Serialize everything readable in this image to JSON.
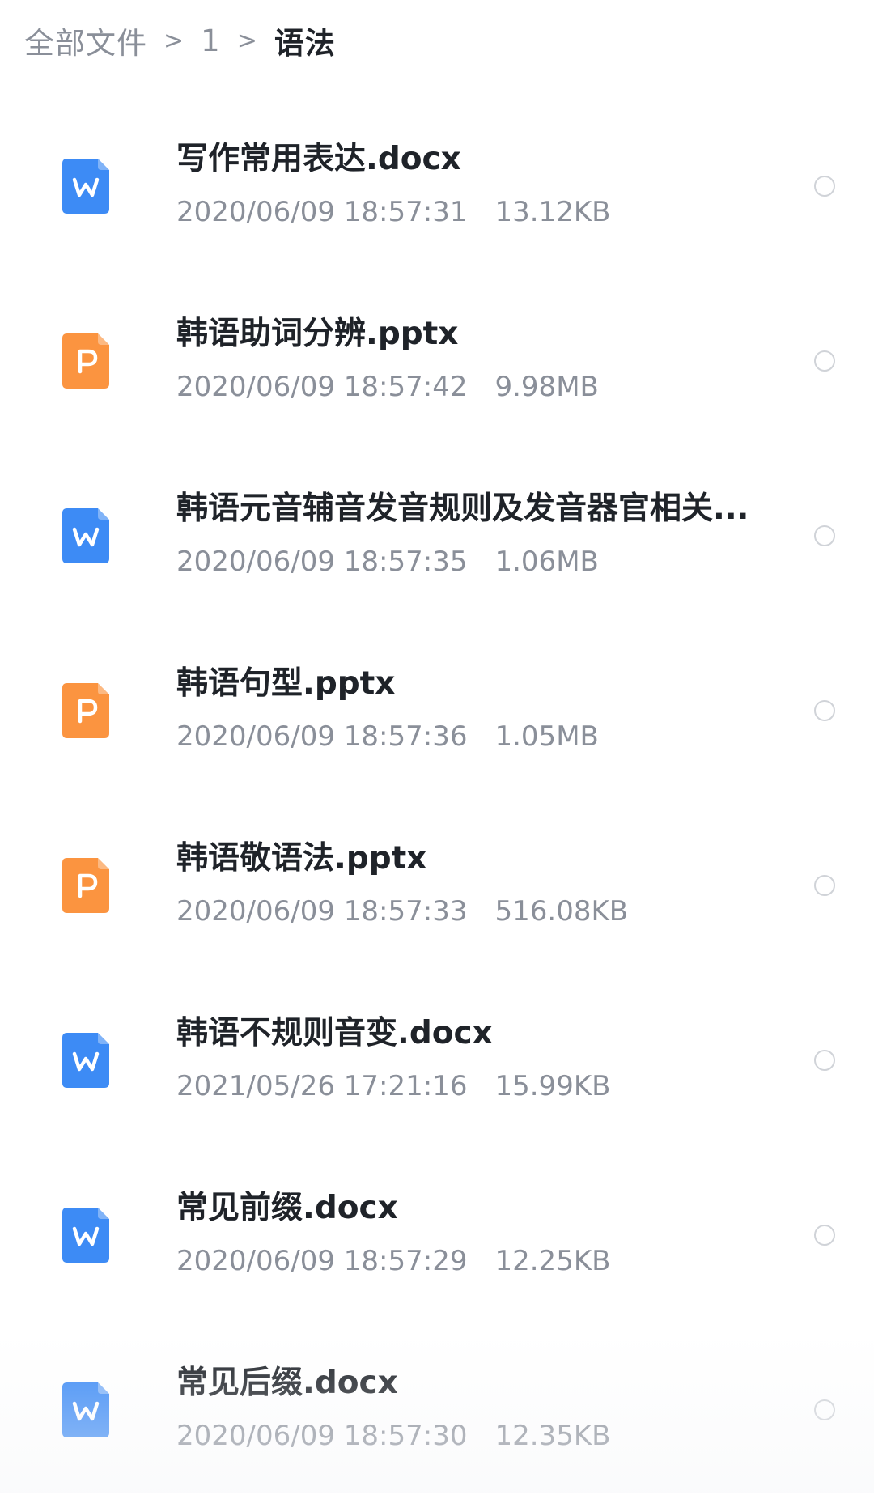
{
  "breadcrumb": {
    "items": [
      "全部文件",
      "1",
      "语法"
    ],
    "separator": ">"
  },
  "icons": {
    "docx": {
      "name": "word-doc-icon",
      "letter": "W",
      "color": "#3d8bf5"
    },
    "pptx": {
      "name": "powerpoint-icon",
      "letter": "P",
      "color": "#fb9440"
    }
  },
  "files": [
    {
      "name": "写作常用表达.docx",
      "type": "docx",
      "date": "2020/06/09 18:57:31",
      "size": "13.12KB"
    },
    {
      "name": "韩语助词分辨.pptx",
      "type": "pptx",
      "date": "2020/06/09 18:57:42",
      "size": "9.98MB"
    },
    {
      "name": "韩语元音辅音发音规则及发音器官相关...",
      "type": "docx",
      "date": "2020/06/09 18:57:35",
      "size": "1.06MB"
    },
    {
      "name": "韩语句型.pptx",
      "type": "pptx",
      "date": "2020/06/09 18:57:36",
      "size": "1.05MB"
    },
    {
      "name": "韩语敬语法.pptx",
      "type": "pptx",
      "date": "2020/06/09 18:57:33",
      "size": "516.08KB"
    },
    {
      "name": "韩语不规则音变.docx",
      "type": "docx",
      "date": "2021/05/26 17:21:16",
      "size": "15.99KB"
    },
    {
      "name": "常见前缀.docx",
      "type": "docx",
      "date": "2020/06/09 18:57:29",
      "size": "12.25KB"
    },
    {
      "name": "常见后缀.docx",
      "type": "docx",
      "date": "2020/06/09 18:57:30",
      "size": "12.35KB"
    }
  ]
}
